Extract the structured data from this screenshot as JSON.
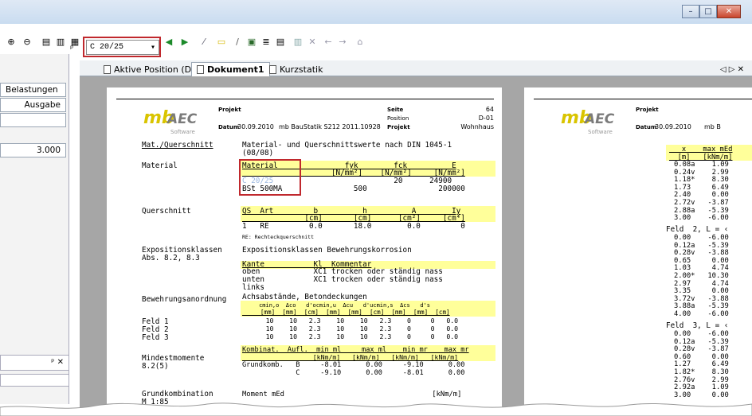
{
  "window": {
    "minimize": "–",
    "maximize": "□",
    "close": "✕"
  },
  "toolbar": {
    "combo_value": "C 20/25",
    "pin": "ᵖ"
  },
  "tabs": {
    "items": [
      "Aktive Position (D-01)",
      "Dokument1",
      "Kurzstatik"
    ],
    "nav": "◁ ▷ ✕"
  },
  "left_panel": {
    "items": [
      "Belastungen",
      "Ausgabe"
    ],
    "value": "3.000",
    "pin_close": "ᵖ ✕"
  },
  "doc": {
    "hdr": {
      "projekt": "Projekt",
      "datum": "Datum",
      "date": "30.09.2010",
      "product": "mb BauStatik S212 2011.10928",
      "projekt2": "Projekt",
      "seite": "Seite",
      "page": "64",
      "position": "Position",
      "pos": "D-01",
      "building": "Wohnhaus",
      "software": "Software",
      "logo_a": "mb",
      "logo_b": "AEC"
    },
    "l_matq": "Mat./Querschnitt",
    "l_material": "Material",
    "l_quer": "Querschnitt",
    "l_expo": "Expositionsklassen\nAbs. 8.2, 8.3",
    "l_bew": "Bewehrungsanordnung",
    "l_felder": "Feld 1\nFeld 2\nFeld 3",
    "l_mindest": "Mindestmomente\n8.2(5)",
    "l_grund": "Grundkombination\nM 1:85",
    "t_matq": "Material- und Querschnittswerte nach DIN 1045-1\n(08/08)",
    "mat_hdr": "Material               fyk        fck          E",
    "mat_units": "                    [N/mm²]    [N/mm²]     [N/mm²]",
    "mat_c": "C 20/25",
    "mat_c_vals": "                                  20      24900",
    "mat_b": "BSt 500MA                500                200000",
    "q_hdr": "QS  Art         b          h          A        Iy",
    "q_units": "              [cm]       [cm]      [cm²]     [cm⁴]",
    "q_row": "1   RE         0.0       18.0        0.0         0",
    "q_note": "RE: Rechteckquerschnitt",
    "e_title": "Expositionsklassen Bewehrungskorrosion",
    "e_hdr": "Kante           Kl  Kommentar",
    "e_rows": "oben            XC1 trocken oder ständig nass\nunten           XC1 trocken oder ständig nass\nlinks",
    "b_title": "Achsabstände, Betondeckungen",
    "b_hdr": "     cmin,o  Δco   d'ocmin,u  Δcu   d'ucmin,s  Δcs   d's",
    "b_units": "     [mm]  [mm]  [cm]  [mm]  [mm]  [cm]  [mm]  [mm]  [cm]",
    "b_rows": "      10    10   2.3    10    10   2.3    0     0   0.0\n      10    10   2.3    10    10   2.3    0     0   0.0\n      10    10   2.3    10    10   2.3    0     0   0.0",
    "m_hdr": "Kombinat.  Aufl.  min ml     max ml    min mr    max mr",
    "m_units": "                  [kNm/m]   [kNm/m]   [kNm/m]   [kNm/m]",
    "m_rows": "Grundkomb.   B     -8.01      0.00     -9.10      0.00\n             C     -9.10      0.00     -8.01      0.00",
    "g_row": "Moment mEd                                   [kNm/m]"
  },
  "doc2": {
    "hdr": {
      "projekt": "Projekt",
      "datum": "Datum",
      "date": "30.09.2010",
      "product": "mb B",
      "software": "Software",
      "logo_a": "mb",
      "logo_b": "AEC"
    },
    "col_hdr": "   x    max mEd\n  [m]   [kNm/m]",
    "rows1": "0.08a    1.09\n0.24v    2.99\n1.18*    8.30\n1.73     6.49\n2.40     0.00\n2.72v   -3.87\n2.88a   -5.39\n3.00    -6.00",
    "feld2": "Feld  2, L = ‹",
    "rows2": "0.00    -6.00\n0.12a   -5.39\n0.28v   -3.88\n0.65     0.00\n1.03     4.74\n2.00*   10.30\n2.97     4.74\n3.35     0.00\n3.72v   -3.88\n3.88a   -5.39\n4.00    -6.00",
    "feld3": "Feld  3, L = ‹",
    "rows3": "0.00    -6.00\n0.12a   -5.39\n0.28v   -3.87\n0.60     0.00\n1.27     6.49\n1.82*    8.30\n2.76v    2.99\n2.92a    1.09\n3.00     0.00"
  }
}
